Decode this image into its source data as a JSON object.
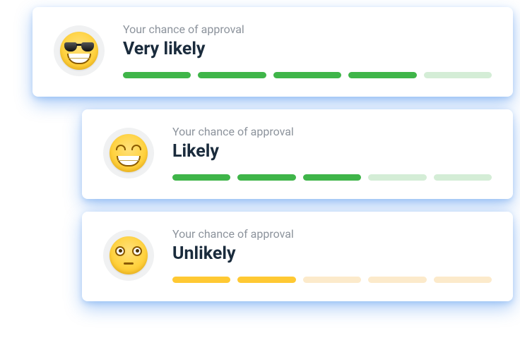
{
  "cards": [
    {
      "subtitle": "Your chance of approval",
      "title": "Very likely",
      "emoji": "cool-sunglasses",
      "bar_color": "green",
      "filled_bars": 4,
      "total_bars": 5
    },
    {
      "subtitle": "Your chance of approval",
      "title": "Likely",
      "emoji": "grin",
      "bar_color": "green",
      "filled_bars": 3,
      "total_bars": 5
    },
    {
      "subtitle": "Your chance of approval",
      "title": "Unlikely",
      "emoji": "flushed",
      "bar_color": "yellow",
      "filled_bars": 2,
      "total_bars": 5
    }
  ],
  "colors": {
    "green_filled": "#3fb549",
    "green_empty": "#d4edd6",
    "yellow_filled": "#ffc933",
    "yellow_empty": "#fceacb"
  }
}
